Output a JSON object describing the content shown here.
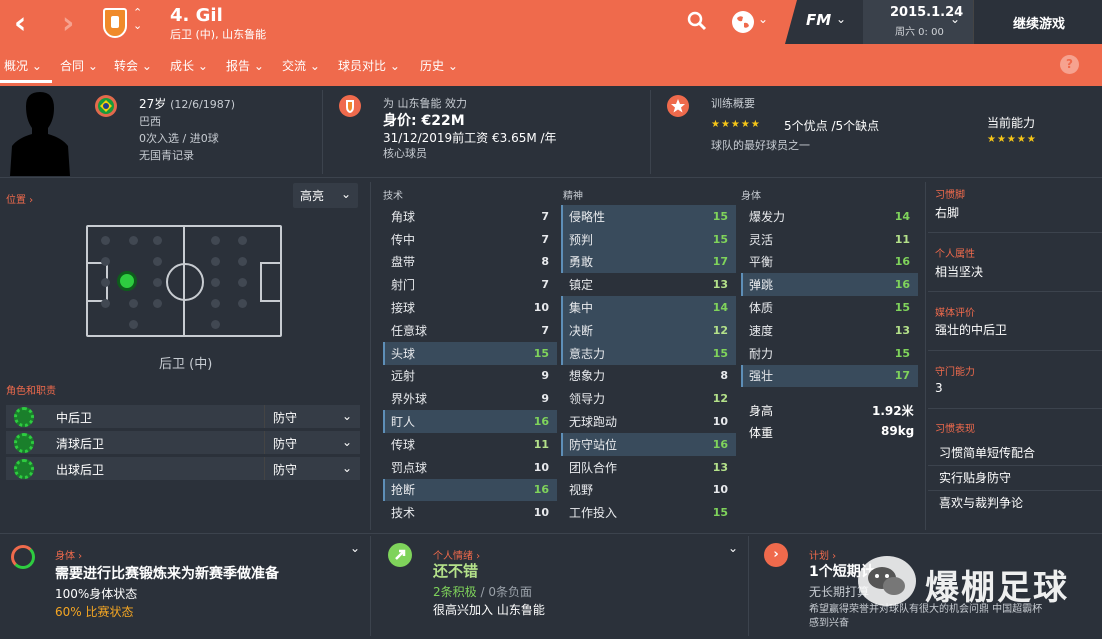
{
  "nav": {
    "back": "‹",
    "forward": "›",
    "updown": "⌃⌄"
  },
  "player": {
    "number_name": "4. Gil",
    "sub": "后卫 (中), 山东鲁能"
  },
  "top": {
    "fm": "FM",
    "date": "2015.1.24",
    "day": "周六 0: 00",
    "continue": "继续游戏"
  },
  "tabs": [
    {
      "label": "概况"
    },
    {
      "label": "合同"
    },
    {
      "label": "转会"
    },
    {
      "label": "成长"
    },
    {
      "label": "报告"
    },
    {
      "label": "交流"
    },
    {
      "label": "球员对比"
    },
    {
      "label": "历史"
    }
  ],
  "help": "?",
  "header": {
    "age": "27岁",
    "dob": "(12/6/1987)",
    "nation": "巴西",
    "caps": "0次入选 / 进0球",
    "youth": "无国青记录",
    "club_line": "为 山东鲁能 效力",
    "value": "身价: €22M",
    "wage": "31/12/2019前工资 €3.65M /年",
    "status": "核心球员",
    "training_title": "训练概要",
    "strengths": "5个优点 /5个缺点",
    "best": "球队的最好球员之一",
    "ability_label": "当前能力",
    "stars_left": "★★★★★",
    "stars_right": "★★★★★"
  },
  "position": {
    "label": "位置 ›",
    "filter": "高亮",
    "name": "后卫 (中)",
    "roles_label": "角色和职责"
  },
  "roles": [
    {
      "name": "中后卫",
      "duty": "防守"
    },
    {
      "name": "清球后卫",
      "duty": "防守"
    },
    {
      "name": "出球后卫",
      "duty": "防守"
    }
  ],
  "attr_headers": {
    "tech": "技术",
    "mental": "精神",
    "phys": "身体"
  },
  "technical": [
    {
      "n": "角球",
      "v": "7",
      "c": "w"
    },
    {
      "n": "传中",
      "v": "7",
      "c": "w"
    },
    {
      "n": "盘带",
      "v": "8",
      "c": "w"
    },
    {
      "n": "射门",
      "v": "7",
      "c": "w"
    },
    {
      "n": "接球",
      "v": "10",
      "c": "w"
    },
    {
      "n": "任意球",
      "v": "7",
      "c": "w"
    },
    {
      "n": "头球",
      "v": "15",
      "c": "g",
      "hl": true
    },
    {
      "n": "远射",
      "v": "9",
      "c": "w"
    },
    {
      "n": "界外球",
      "v": "9",
      "c": "w"
    },
    {
      "n": "盯人",
      "v": "16",
      "c": "g",
      "hl": true
    },
    {
      "n": "传球",
      "v": "11",
      "c": "gg"
    },
    {
      "n": "罚点球",
      "v": "10",
      "c": "w"
    },
    {
      "n": "抢断",
      "v": "16",
      "c": "g",
      "hl": true
    },
    {
      "n": "技术",
      "v": "10",
      "c": "w"
    }
  ],
  "mental": [
    {
      "n": "侵略性",
      "v": "15",
      "c": "g",
      "hl": true
    },
    {
      "n": "预判",
      "v": "15",
      "c": "g",
      "hl": true
    },
    {
      "n": "勇敢",
      "v": "17",
      "c": "g",
      "hl": true
    },
    {
      "n": "镇定",
      "v": "13",
      "c": "gg"
    },
    {
      "n": "集中",
      "v": "14",
      "c": "g",
      "hl": true
    },
    {
      "n": "决断",
      "v": "12",
      "c": "gg",
      "hl": true
    },
    {
      "n": "意志力",
      "v": "15",
      "c": "g",
      "hl": true
    },
    {
      "n": "想象力",
      "v": "8",
      "c": "w"
    },
    {
      "n": "领导力",
      "v": "12",
      "c": "gg"
    },
    {
      "n": "无球跑动",
      "v": "10",
      "c": "w"
    },
    {
      "n": "防守站位",
      "v": "16",
      "c": "g",
      "hl": true
    },
    {
      "n": "团队合作",
      "v": "13",
      "c": "gg"
    },
    {
      "n": "视野",
      "v": "10",
      "c": "w"
    },
    {
      "n": "工作投入",
      "v": "15",
      "c": "g"
    }
  ],
  "physical": [
    {
      "n": "爆发力",
      "v": "14",
      "c": "g"
    },
    {
      "n": "灵活",
      "v": "11",
      "c": "gg"
    },
    {
      "n": "平衡",
      "v": "16",
      "c": "g"
    },
    {
      "n": "弹跳",
      "v": "16",
      "c": "g",
      "hl": true
    },
    {
      "n": "体质",
      "v": "15",
      "c": "g"
    },
    {
      "n": "速度",
      "v": "13",
      "c": "gg"
    },
    {
      "n": "耐力",
      "v": "15",
      "c": "g"
    },
    {
      "n": "强壮",
      "v": "17",
      "c": "g",
      "hl": true
    }
  ],
  "body": {
    "height_label": "身高",
    "height": "1.92米",
    "weight_label": "体重",
    "weight": "89kg"
  },
  "right": {
    "foot_label": "习惯脚",
    "foot": "右脚",
    "trait_label": "个人属性",
    "trait": "相当坚决",
    "media_label": "媒体评价",
    "media": "强壮的中后卫",
    "gk_label": "守门能力",
    "gk": "3",
    "habits_label": "习惯表现",
    "habits": [
      "习惯简单短传配合",
      "实行贴身防守",
      "喜欢与裁判争论"
    ]
  },
  "bottom": {
    "phys_label": "身体 ›",
    "phys_title": "需要进行比赛锻炼来为新赛季做准备",
    "phys_1": "100%身体状态",
    "phys_2": "60% 比赛状态",
    "mood_label": "个人情绪 ›",
    "mood": "还不错",
    "mood_pos": "2条积极",
    "mood_neg": "/ 0条负面",
    "mood_desc": "很高兴加入 山东鲁能",
    "plan_label": "计划 ›",
    "plan": "1个短期计",
    "plan_sub": "无长期打算",
    "plan_desc": "希望赢得荣誉并对球队有很大的机会问鼎 中国超霸杯",
    "plan_desc2": "感到兴奋"
  },
  "watermark": "爆棚足球",
  "colors": {
    "accent": "#ef6a4c",
    "bg": "#2b313a",
    "green": "#7fd35b"
  }
}
